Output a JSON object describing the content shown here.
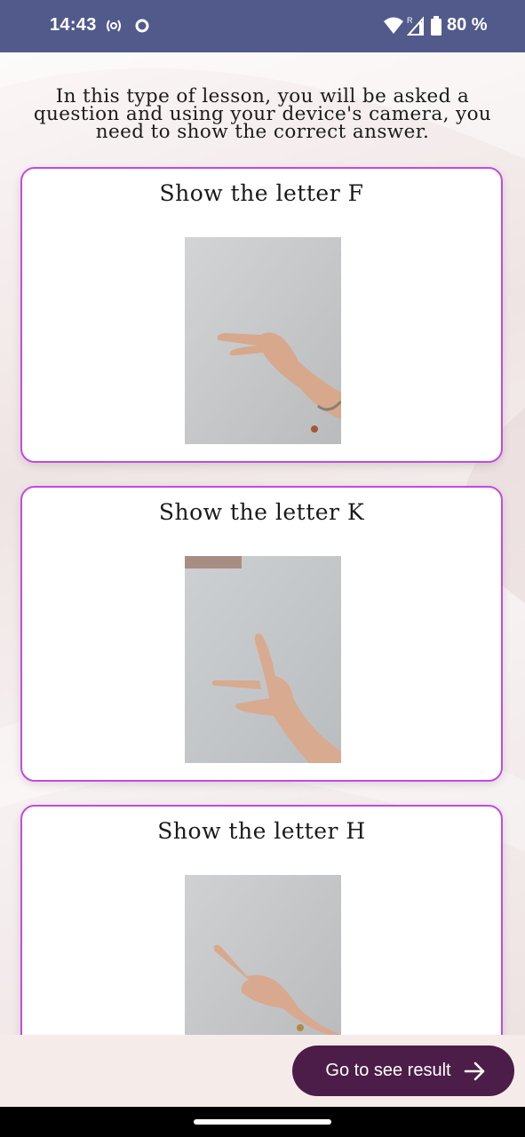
{
  "status_bar": {
    "time": "14:43",
    "battery": "80 %",
    "icons": [
      "radio-signal-icon",
      "record-icon",
      "wifi-icon",
      "cellular-roaming-icon",
      "battery-icon"
    ]
  },
  "intro_text": "In this type of lesson, you will be asked a question and using your device's camera, you need to show the correct answer.",
  "cards": [
    {
      "title": "Show the letter F"
    },
    {
      "title": "Show the letter K"
    },
    {
      "title": "Show the letter H"
    }
  ],
  "result_button": {
    "label": "Go to see result",
    "icon": "arrow-right-icon"
  },
  "colors": {
    "status_bar": "#525a8c",
    "card_border": "#c34ae0",
    "button": "#4c1d48"
  }
}
